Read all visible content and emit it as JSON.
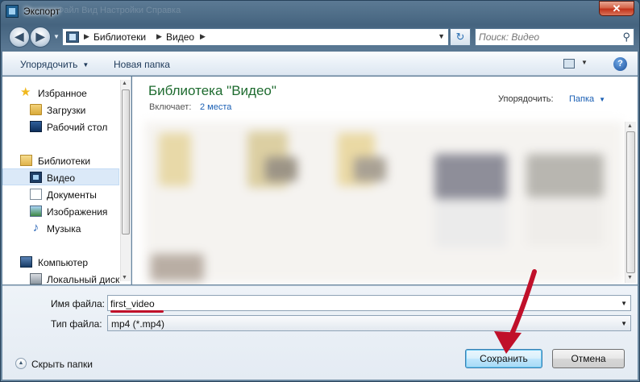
{
  "window": {
    "title": "Экспорт",
    "close_label": "✕",
    "ghost_menu": "Файл   Вид   Настройки   Справка"
  },
  "address": {
    "crumbs": [
      "Библиотеки",
      "Видео"
    ],
    "search_placeholder": "Поиск: Видео"
  },
  "toolbar": {
    "organize_label": "Упорядочить",
    "new_folder_label": "Новая папка",
    "help_label": "?"
  },
  "sidebar": {
    "items": [
      {
        "label": "Избранное",
        "icon": "star-icon"
      },
      {
        "label": "Загрузки",
        "icon": "downloads-folder-icon"
      },
      {
        "label": "Рабочий стол",
        "icon": "desktop-icon"
      },
      {
        "label": "Библиотеки",
        "icon": "libraries-icon"
      },
      {
        "label": "Видео",
        "icon": "video-icon",
        "selected": true
      },
      {
        "label": "Документы",
        "icon": "documents-icon"
      },
      {
        "label": "Изображения",
        "icon": "pictures-icon"
      },
      {
        "label": "Музыка",
        "icon": "music-icon"
      },
      {
        "label": "Компьютер",
        "icon": "computer-icon"
      },
      {
        "label": "Локальный диск",
        "icon": "local-disk-icon"
      }
    ]
  },
  "content": {
    "library_title": "Библиотека \"Видео\"",
    "includes_label": "Включает:",
    "includes_link": "2 места",
    "arrange_label": "Упорядочить:",
    "arrange_value": "Папка"
  },
  "fields": {
    "filename_label": "Имя файла:",
    "filename_value": "first_video",
    "filetype_label": "Тип файла:",
    "filetype_value": "mp4 (*.mp4)"
  },
  "footer": {
    "hide_folders_label": "Скрыть папки",
    "save_label": "Сохранить",
    "cancel_label": "Отмена"
  },
  "colors": {
    "library_title": "#1e6b2f",
    "link": "#1a5fb4",
    "annotation_arrow": "#c0102a",
    "selected_bg": "#dbe9f8"
  }
}
